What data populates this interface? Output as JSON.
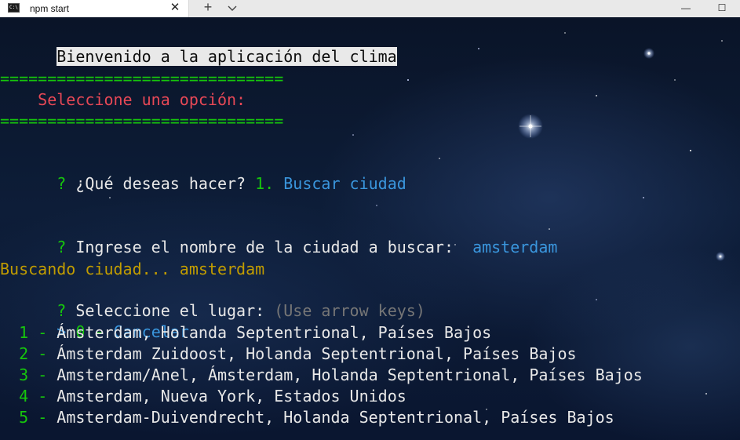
{
  "window": {
    "tab_title": "npm start",
    "tab_icon_text": "C:\\",
    "new_tab_label": "+",
    "close_label": "✕",
    "minimize_label": "—",
    "maximize_label": "☐"
  },
  "terminal": {
    "welcome": "Bienvenido a la aplicación del clima",
    "separator_top": "==============================",
    "menu_title": "    Seleccione una opción:",
    "separator_bottom": "==============================",
    "prompt_mark": "?",
    "q1_question": " ¿Qué deseas hacer? ",
    "q1_answer_number": "1.",
    "q1_answer_text": " Buscar ciudad",
    "q2_question": " Ingrese el nombre de la ciudad a buscar:  ",
    "q2_answer": "amsterdam",
    "searching": "Buscando ciudad... amsterdam",
    "q3_question": " Seleccione el lugar: ",
    "q3_hint": "(Use arrow keys)",
    "cursor": ">",
    "options": [
      {
        "number": "0",
        "dash": "-",
        "label": "Cancelar"
      },
      {
        "number": "1",
        "dash": "-",
        "label": "Ámsterdam, Holanda Septentrional, Países Bajos"
      },
      {
        "number": "2",
        "dash": "-",
        "label": "Ámsterdam Zuidoost, Holanda Septentrional, Países Bajos"
      },
      {
        "number": "3",
        "dash": "-",
        "label": "Amsterdam/Anel, Ámsterdam, Holanda Septentrional, Países Bajos"
      },
      {
        "number": "4",
        "dash": "-",
        "label": "Amsterdam, Nueva York, Estados Unidos"
      },
      {
        "number": "5",
        "dash": "-",
        "label": "Amsterdam-Duivendrecht, Holanda Septentrional, Países Bajos"
      }
    ]
  },
  "colors": {
    "green": "#16c60c",
    "red": "#e74856",
    "cyan": "#3a96dd",
    "yellow": "#c19c00",
    "grey": "#767676"
  }
}
